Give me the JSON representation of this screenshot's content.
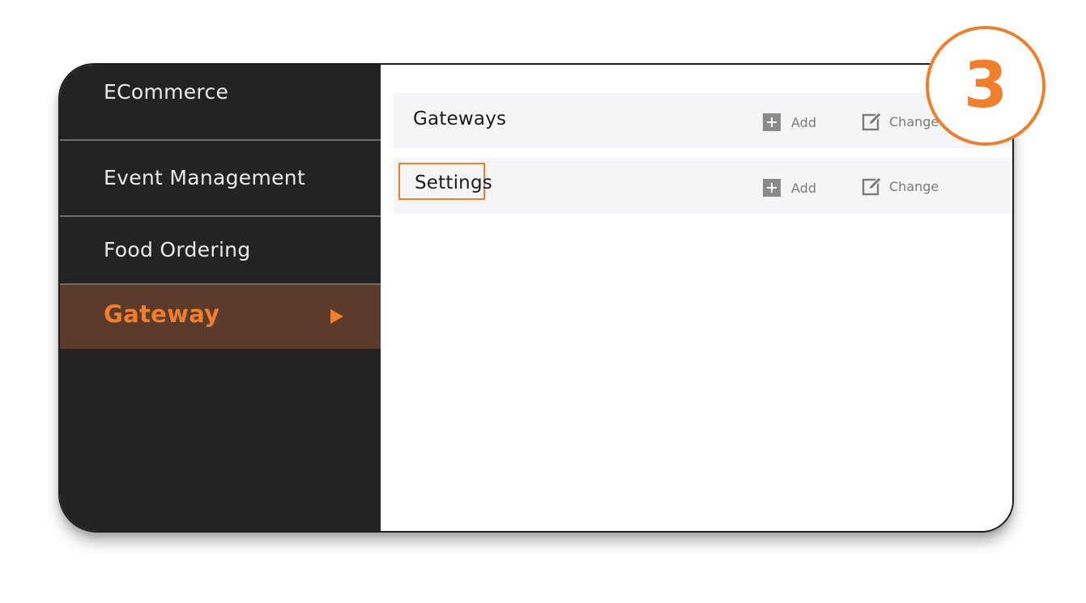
{
  "sidebar": {
    "items": [
      {
        "label": "ECommerce"
      },
      {
        "label": "Event Management"
      },
      {
        "label": "Food Ordering"
      },
      {
        "label": "Gateway",
        "active": true
      }
    ]
  },
  "content": {
    "rows": [
      {
        "title": "Gateways",
        "add_label": "Add",
        "change_label": "Change"
      },
      {
        "title": "Settings",
        "add_label": "Add",
        "change_label": "Change",
        "highlighted": true
      }
    ]
  },
  "step_badge": {
    "number": "3"
  },
  "colors": {
    "accent": "#f07e2a",
    "sidebar_bg": "#232323",
    "active_item_bg": "#5b3c2c",
    "row_bg": "#f4f5f7"
  },
  "icons": {
    "active_indicator": "play-arrow-icon",
    "add": "plus-icon",
    "change": "edit-icon"
  }
}
